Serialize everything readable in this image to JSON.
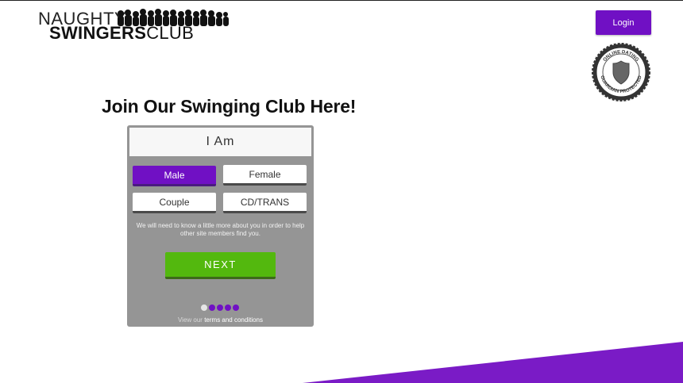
{
  "header": {
    "logo_line1": "NAUGHTY",
    "logo_line2_bold": "SWINGERS",
    "logo_line2_light": "CLUB",
    "login_label": "Login"
  },
  "badge": {
    "top_text": "ONLINE DATING",
    "bottom_text": "GUARDIAN PROTECTED"
  },
  "main": {
    "headline": "Join Our Swinging Club Here!"
  },
  "form": {
    "title": "I Am",
    "options": [
      {
        "label": "Male",
        "selected": true
      },
      {
        "label": "Female",
        "selected": false
      },
      {
        "label": "Couple",
        "selected": false
      },
      {
        "label": "CD/TRANS",
        "selected": false
      }
    ],
    "note": "We will need to know a little more about you in order to help other site members find you.",
    "next_label": "NEXT",
    "progress": {
      "current_step": 1,
      "total_steps": 5
    },
    "terms_prefix": "View our",
    "terms_link": "terms and conditions"
  },
  "colors": {
    "accent": "#7010c4",
    "next_green": "#53b80e",
    "card_gray": "#959595"
  }
}
